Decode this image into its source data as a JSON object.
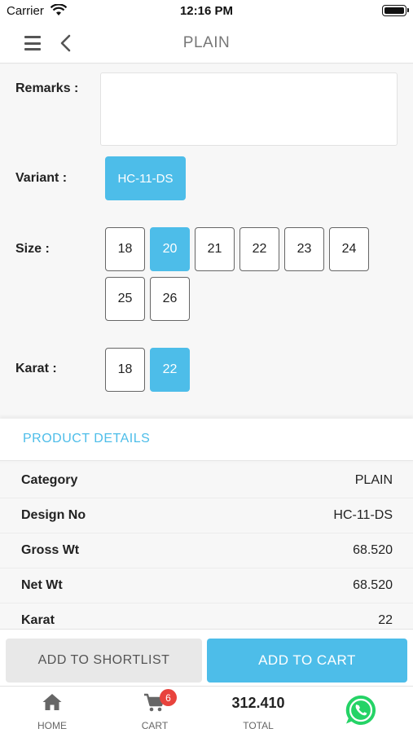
{
  "status_bar": {
    "carrier": "Carrier",
    "time": "12:16 PM"
  },
  "nav": {
    "title": "PLAIN"
  },
  "options": {
    "remarks_label": "Remarks :",
    "remarks_value": "",
    "variant_label": "Variant :",
    "variant_value": "HC-11-DS",
    "size_label": "Size :",
    "sizes": [
      "18",
      "20",
      "21",
      "22",
      "23",
      "24",
      "25",
      "26"
    ],
    "selected_size": "20",
    "karat_label": "Karat :",
    "karats": [
      "18",
      "22"
    ],
    "selected_karat": "22"
  },
  "details": {
    "header": "PRODUCT DETAILS",
    "rows": [
      {
        "key": "Category",
        "value": "PLAIN"
      },
      {
        "key": "Design No",
        "value": "HC-11-DS"
      },
      {
        "key": "Gross Wt",
        "value": "68.520"
      },
      {
        "key": "Net Wt",
        "value": "68.520"
      },
      {
        "key": "Karat",
        "value": "22"
      }
    ]
  },
  "actions": {
    "shortlist_label": "ADD TO SHORTLIST",
    "cart_label": "ADD TO CART"
  },
  "tab_bar": {
    "home_label": "HOME",
    "cart_label": "CART",
    "cart_count": "6",
    "total_value": "312.410",
    "total_label": "TOTAL"
  },
  "colors": {
    "accent": "#4dbde9",
    "badge": "#e8433d",
    "whatsapp": "#25d366"
  },
  "icons": [
    "wifi-icon",
    "battery-icon",
    "menu-icon",
    "back-icon",
    "home-icon",
    "cart-icon",
    "whatsapp-icon"
  ]
}
